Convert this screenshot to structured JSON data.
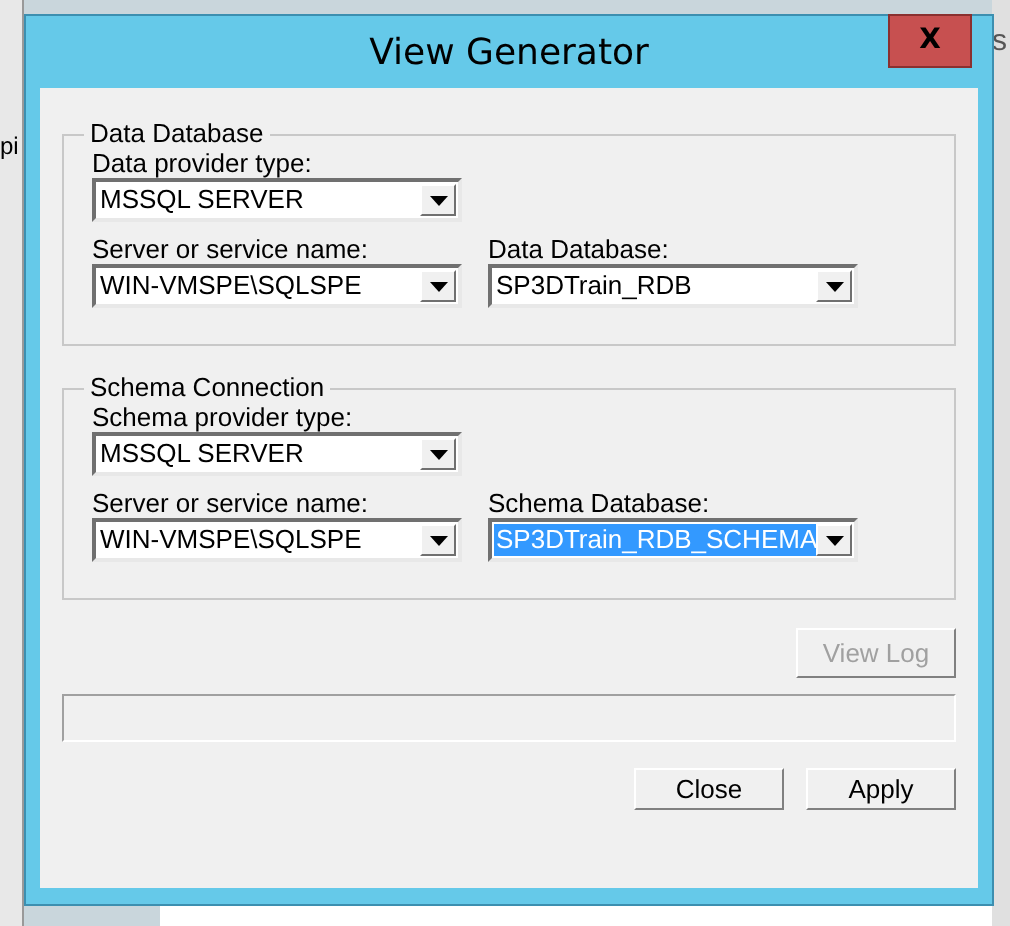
{
  "background": {
    "top_right_text": "s",
    "left_text": "pi"
  },
  "window": {
    "title": "View Generator",
    "close_symbol": "X"
  },
  "groups": [
    {
      "title": "Data Database",
      "rows": [
        [
          {
            "label": "Data provider type:",
            "value": "MSSQL SERVER",
            "highlighted": false
          }
        ],
        [
          {
            "label": "Server or service name:",
            "value": "WIN-VMSPE\\SQLSPE",
            "highlighted": false
          },
          {
            "label": "Data Database:",
            "value": "SP3DTrain_RDB",
            "highlighted": false
          }
        ]
      ]
    },
    {
      "title": "Schema Connection",
      "rows": [
        [
          {
            "label": "Schema provider type:",
            "value": "MSSQL SERVER",
            "highlighted": false
          }
        ],
        [
          {
            "label": "Server or service name:",
            "value": "WIN-VMSPE\\SQLSPE",
            "highlighted": false
          },
          {
            "label": "Schema Database:",
            "value": "SP3DTrain_RDB_SCHEMA",
            "highlighted": true
          }
        ]
      ]
    }
  ],
  "view_log_button": {
    "label": "View Log",
    "disabled": true
  },
  "buttons": [
    {
      "label": "Close",
      "disabled": false
    },
    {
      "label": "Apply",
      "disabled": false
    }
  ]
}
